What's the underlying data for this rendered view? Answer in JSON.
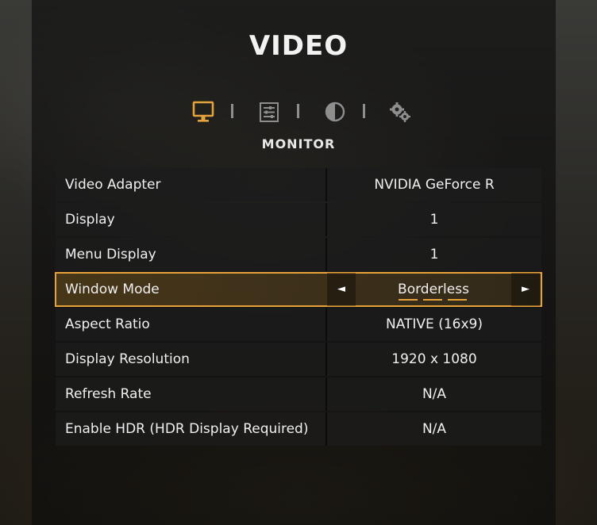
{
  "page": {
    "title": "VIDEO",
    "subtitle": "MONITOR"
  },
  "tabs": [
    {
      "name": "monitor",
      "icon": "monitor-icon",
      "active": true
    },
    {
      "name": "sliders",
      "icon": "sliders-icon",
      "active": false
    },
    {
      "name": "contrast",
      "icon": "contrast-icon",
      "active": false
    },
    {
      "name": "advanced",
      "icon": "gears-icon",
      "active": false
    }
  ],
  "colors": {
    "accent": "#e6a33a",
    "text": "#f0f0f0",
    "inactive_icon": "#8e8e8e"
  },
  "settings": [
    {
      "label": "Video Adapter",
      "value": "NVIDIA GeForce R"
    },
    {
      "label": "Display",
      "value": "1"
    },
    {
      "label": "Menu Display",
      "value": "1"
    },
    {
      "label": "Window Mode",
      "value": "Borderless",
      "selected": true,
      "left_arrow": "◄",
      "right_arrow": "►"
    },
    {
      "label": "Aspect Ratio",
      "value": "NATIVE (16x9)"
    },
    {
      "label": "Display Resolution",
      "value": "1920 x 1080"
    },
    {
      "label": "Refresh Rate",
      "value": "N/A"
    },
    {
      "label": "Enable HDR (HDR Display Required)",
      "value": "N/A"
    }
  ]
}
